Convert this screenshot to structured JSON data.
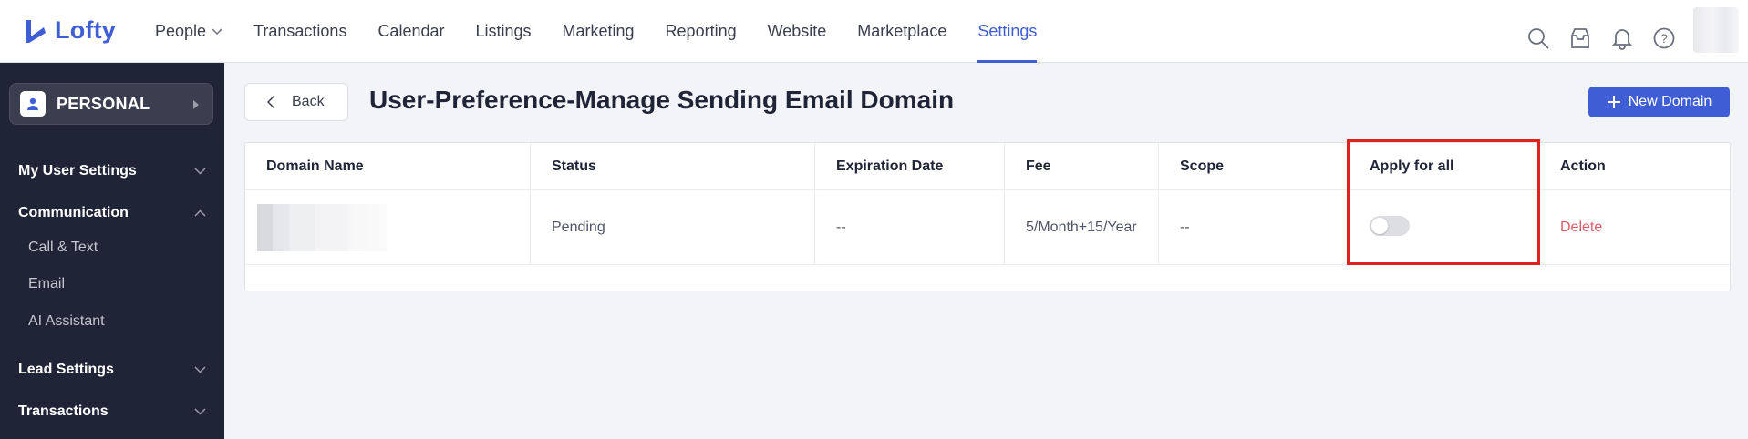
{
  "brand": {
    "name": "Lofty",
    "color": "#3f5ed6"
  },
  "nav": {
    "items": [
      {
        "label": "People",
        "has_dropdown": true
      },
      {
        "label": "Transactions"
      },
      {
        "label": "Calendar"
      },
      {
        "label": "Listings"
      },
      {
        "label": "Marketing"
      },
      {
        "label": "Reporting"
      },
      {
        "label": "Website"
      },
      {
        "label": "Marketplace"
      },
      {
        "label": "Settings",
        "active": true
      }
    ],
    "icons": [
      "search-icon",
      "inbox-icon",
      "bell-icon",
      "help-icon",
      "avatar"
    ]
  },
  "sidebar": {
    "account_label": "PERSONAL",
    "sections": [
      {
        "label": "My User Settings",
        "expanded": false
      },
      {
        "label": "Communication",
        "expanded": true,
        "items": [
          "Call & Text",
          "Email",
          "AI Assistant"
        ]
      },
      {
        "label": "Lead Settings",
        "expanded": false
      },
      {
        "label": "Transactions",
        "expanded": false
      }
    ]
  },
  "page": {
    "back_label": "Back",
    "title": "User-Preference-Manage Sending Email Domain",
    "new_button_label": "New Domain"
  },
  "table": {
    "columns": [
      "Domain Name",
      "Status",
      "Expiration Date",
      "Fee",
      "Scope",
      "Apply for all",
      "Action"
    ],
    "rows": [
      {
        "domain_name": "",
        "status": "Pending",
        "expiration_date": "--",
        "fee": "5/Month+15/Year",
        "scope": "--",
        "apply_for_all": false,
        "action": "Delete"
      }
    ]
  },
  "colors": {
    "accent": "#3f5ed6",
    "danger": "#e35b65",
    "sidebar_bg": "#202437",
    "highlight": "#e0221c"
  }
}
